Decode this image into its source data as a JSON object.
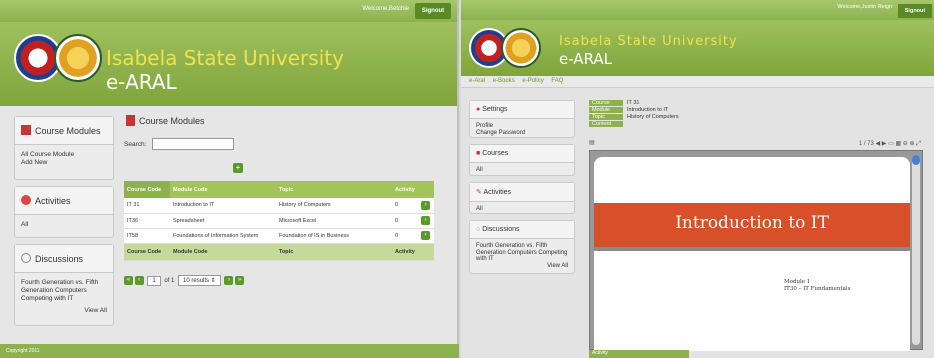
{
  "left": {
    "welcome": "Welcome,Betchie",
    "signout": "Signout",
    "brand_title": "Isabela State University",
    "brand_sub": "e-ARAL",
    "sidebar": {
      "course_modules": {
        "title": "Course Modules",
        "items": [
          "All Course Module",
          "Add New"
        ]
      },
      "activities": {
        "title": "Activities",
        "items": [
          "All"
        ]
      },
      "discussions": {
        "title": "Discussions",
        "body": "Fourth Generation vs. Fifth Generation Computers Competing with IT",
        "view_all": "View All"
      }
    },
    "content": {
      "title": "Course Modules",
      "search_label": "Search:",
      "table": {
        "headers": [
          "Course Code",
          "Module Code",
          "Topic",
          "Activity"
        ],
        "rows": [
          [
            "IT 31",
            "Introduction to IT",
            "History of Computers",
            "0"
          ],
          [
            "IT36",
            "Spreadsheet",
            "Microsoft Excel",
            "0"
          ],
          [
            "IT58",
            "Foundations of Information System",
            "Foundation of IS in Business",
            "0"
          ]
        ],
        "footer": [
          "Course Code",
          "Module Code",
          "Topic",
          "Activity"
        ]
      },
      "pager": {
        "page": "1",
        "of": "of 1",
        "results": "10 results"
      }
    },
    "footer": "Copyright 2011"
  },
  "right": {
    "welcome": "Welcome,Justin Reign",
    "signout": "Signout",
    "brand_title": "Isabela State University",
    "brand_sub": "e-ARAL",
    "nav": [
      "e-Aral",
      "e-Books",
      "e-Policy",
      "FAQ"
    ],
    "sidebar": {
      "settings": {
        "title": "Settings",
        "items": [
          "Profile",
          "Change Password"
        ]
      },
      "courses": {
        "title": "Courses",
        "items": [
          "All"
        ]
      },
      "activities": {
        "title": "Activities",
        "items": [
          "All"
        ]
      },
      "discussions": {
        "title": "Discussions",
        "body": "Fourth Generation vs. Fifth Generation Computers Competing with IT",
        "view_all": "View All"
      }
    },
    "meta": [
      {
        "label": "Course",
        "value": "IT 31"
      },
      {
        "label": "Module",
        "value": "Introduction to IT"
      },
      {
        "label": "Topic",
        "value": "History of Computers"
      },
      {
        "label": "Content",
        "value": ""
      }
    ],
    "viewer": {
      "page": "1 / 73",
      "title": "Introduction to IT",
      "sub1": "Module 1",
      "sub2": "IT30 – IT Fundamentals"
    },
    "bottom": "Activity"
  }
}
